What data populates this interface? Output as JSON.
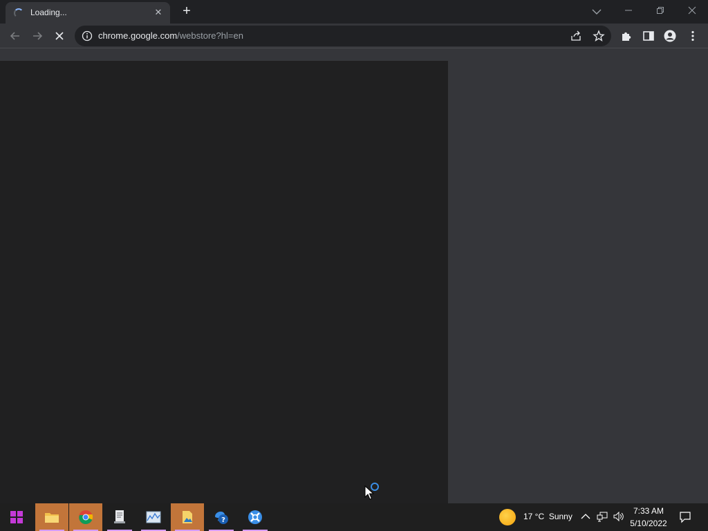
{
  "browser": {
    "tab": {
      "title": "Loading...",
      "close_glyph": "✕"
    },
    "new_tab_glyph": "+",
    "address": {
      "host": "chrome.google.com",
      "path": "/webstore?hl=en"
    }
  },
  "taskbar": {
    "apps": [
      "file-explorer",
      "chrome",
      "document-app",
      "chart-app",
      "pictures-app",
      "help-app",
      "settings-app"
    ],
    "weather": {
      "temp": "17 °C",
      "condition": "Sunny"
    },
    "clock": {
      "time": "7:33 AM",
      "date": "5/10/2022"
    }
  },
  "colors": {
    "accent": "#8ab4f8",
    "taskbar_active": "#c2753a",
    "busy_indicator": "#3a8ee6"
  }
}
